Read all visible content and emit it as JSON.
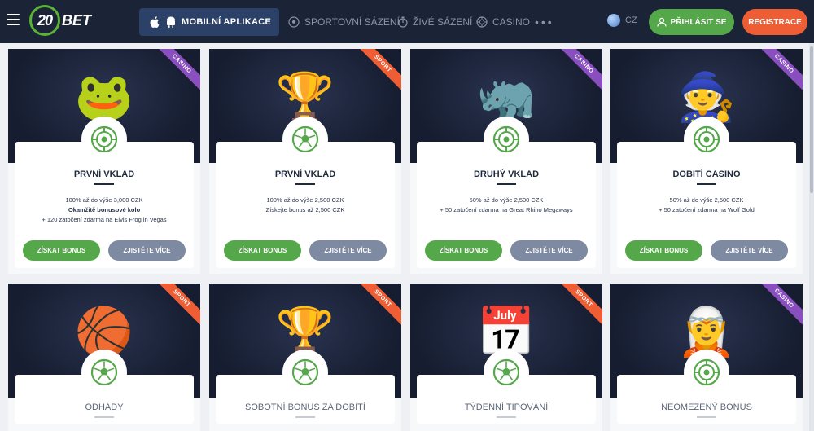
{
  "header": {
    "logo_number": "20",
    "logo_text": "BET",
    "app_button_label": "MOBILNÍ APLIKACE",
    "nav": [
      {
        "label": "SPORTOVNÍ SÁZENÍ",
        "icon": "soccer-ball-icon"
      },
      {
        "label": "ŽIVÉ SÁZENÍ",
        "icon": "stopwatch-icon"
      },
      {
        "label": "CASINO",
        "icon": "casino-chip-icon"
      }
    ],
    "more": "•••",
    "language": "CZ",
    "login_label": "PŘIHLÁSIT SE",
    "register_label": "REGISTRACE"
  },
  "cards_top": [
    {
      "tag": "CASINO",
      "title": "PRVNÍ VKLAD",
      "badge_icon": "roulette-icon",
      "lines": [
        "100% až do výše 3,000 CZK",
        "Okamžitě bonusové kolo",
        "+ 120 zatočení zdarma na Elvis Frog in Vegas"
      ],
      "btn_primary": "ZÍSKAT BONUS",
      "btn_secondary": "ZJISTĚTE VÍCE"
    },
    {
      "tag": "SPORT",
      "title": "PRVNÍ VKLAD",
      "badge_icon": "soccer-ball-icon",
      "lines": [
        "100% až do výše 2,500 CZK",
        "Získejte bonus až 2,500 CZK"
      ],
      "btn_primary": "ZÍSKAT BONUS",
      "btn_secondary": "ZJISTĚTE VÍCE"
    },
    {
      "tag": "CASINO",
      "title": "DRUHÝ VKLAD",
      "badge_icon": "roulette-icon",
      "lines": [
        "50% až do výše 2,500 CZK",
        "+ 50 zatočení zdarma na Great Rhino Megaways"
      ],
      "btn_primary": "ZÍSKAT BONUS",
      "btn_secondary": "ZJISTĚTE VÍCE"
    },
    {
      "tag": "CASINO",
      "title": "DOBITÍ CASINO",
      "badge_icon": "roulette-icon",
      "lines": [
        "50% až do výše 2,500 CZK",
        "+ 50 zatočení zdarma na Wolf Gold"
      ],
      "btn_primary": "ZÍSKAT BONUS",
      "btn_secondary": "ZJISTĚTE VÍCE"
    }
  ],
  "cards_bottom": [
    {
      "tag": "SPORT",
      "title": "ODHADY",
      "badge_icon": "soccer-ball-icon"
    },
    {
      "tag": "SPORT",
      "title": "SOBOTNÍ BONUS ZA DOBITÍ",
      "badge_icon": "soccer-ball-icon"
    },
    {
      "tag": "SPORT",
      "title": "TÝDENNÍ TIPOVÁNÍ",
      "badge_icon": "soccer-ball-icon"
    },
    {
      "tag": "CASINO",
      "title": "NEOMEZENÝ BONUS",
      "badge_icon": "roulette-icon"
    }
  ],
  "colors": {
    "header_bg": "#1a2436",
    "green": "#55a84a",
    "orange": "#ee5d33",
    "casino_tag": "#8a4fbf",
    "secondary_btn": "#7d8aa1"
  }
}
